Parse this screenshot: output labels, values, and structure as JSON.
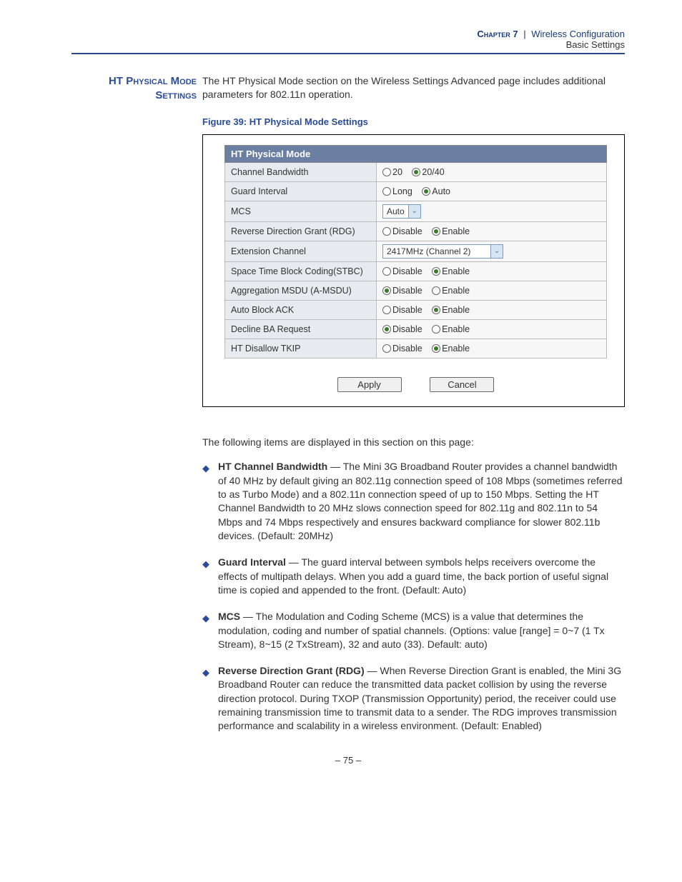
{
  "header": {
    "chapter": "Chapter 7",
    "section": "Wireless Configuration",
    "subsection": "Basic Settings"
  },
  "sideHeading": "HT Physical Mode Settings",
  "introText": "The HT Physical Mode section on the Wireless Settings Advanced page includes additional parameters for 802.11n operation.",
  "figureCaption": "Figure 39:  HT Physical Mode Settings",
  "panel": {
    "title": "HT Physical Mode",
    "rows": {
      "channelBandwidth": {
        "label": "Channel Bandwidth",
        "opt1": "20",
        "opt2": "20/40"
      },
      "guardInterval": {
        "label": "Guard Interval",
        "opt1": "Long",
        "opt2": "Auto"
      },
      "mcs": {
        "label": "MCS",
        "value": "Auto"
      },
      "rdg": {
        "label": "Reverse Direction Grant (RDG)",
        "opt1": "Disable",
        "opt2": "Enable"
      },
      "extChannel": {
        "label": "Extension Channel",
        "value": "2417MHz (Channel 2)"
      },
      "stbc": {
        "label": "Space Time Block Coding(STBC)",
        "opt1": "Disable",
        "opt2": "Enable"
      },
      "amsdu": {
        "label": "Aggregation MSDU (A-MSDU)",
        "opt1": "Disable",
        "opt2": "Enable"
      },
      "autoBlockAck": {
        "label": "Auto Block ACK",
        "opt1": "Disable",
        "opt2": "Enable"
      },
      "declineBA": {
        "label": "Decline BA Request",
        "opt1": "Disable",
        "opt2": "Enable"
      },
      "disallowTkip": {
        "label": "HT Disallow TKIP",
        "opt1": "Disable",
        "opt2": "Enable"
      }
    },
    "buttons": {
      "apply": "Apply",
      "cancel": "Cancel"
    }
  },
  "leadIn": "The following items are displayed in this section on this page:",
  "bullets": [
    {
      "term": "HT Channel Bandwidth",
      "desc": " — The Mini 3G Broadband Router provides a channel bandwidth of 40 MHz by default giving an 802.11g connection speed of 108 Mbps (sometimes referred to as Turbo Mode) and a 802.11n connection speed of up to 150 Mbps. Setting the HT Channel Bandwidth to 20 MHz slows connection speed for 802.11g and 802.11n to 54 Mbps and 74 Mbps respectively and ensures backward compliance for slower 802.11b devices. (Default: 20MHz)"
    },
    {
      "term": "Guard Interval",
      "desc": " — The guard interval between symbols helps receivers overcome the effects of multipath delays. When you add a guard time, the back portion of useful signal time is copied and appended to the front. (Default: Auto)"
    },
    {
      "term": "MCS",
      "desc": " — The Modulation and Coding Scheme (MCS) is a value that determines the modulation, coding and number of spatial channels. (Options: value [range] = 0~7 (1 Tx Stream), 8~15 (2 TxStream), 32 and auto (33). Default: auto)"
    },
    {
      "term": "Reverse Direction Grant (RDG)",
      "desc": " — When Reverse Direction Grant is enabled, the Mini 3G Broadband Router can reduce the transmitted data packet collision by using the reverse direction protocol. During TXOP (Transmission Opportunity) period, the receiver could use remaining transmission time to transmit data to a sender. The RDG improves transmission performance and scalability in a wireless environment. (Default: Enabled)"
    }
  ],
  "pageNumber": "–  75  –"
}
